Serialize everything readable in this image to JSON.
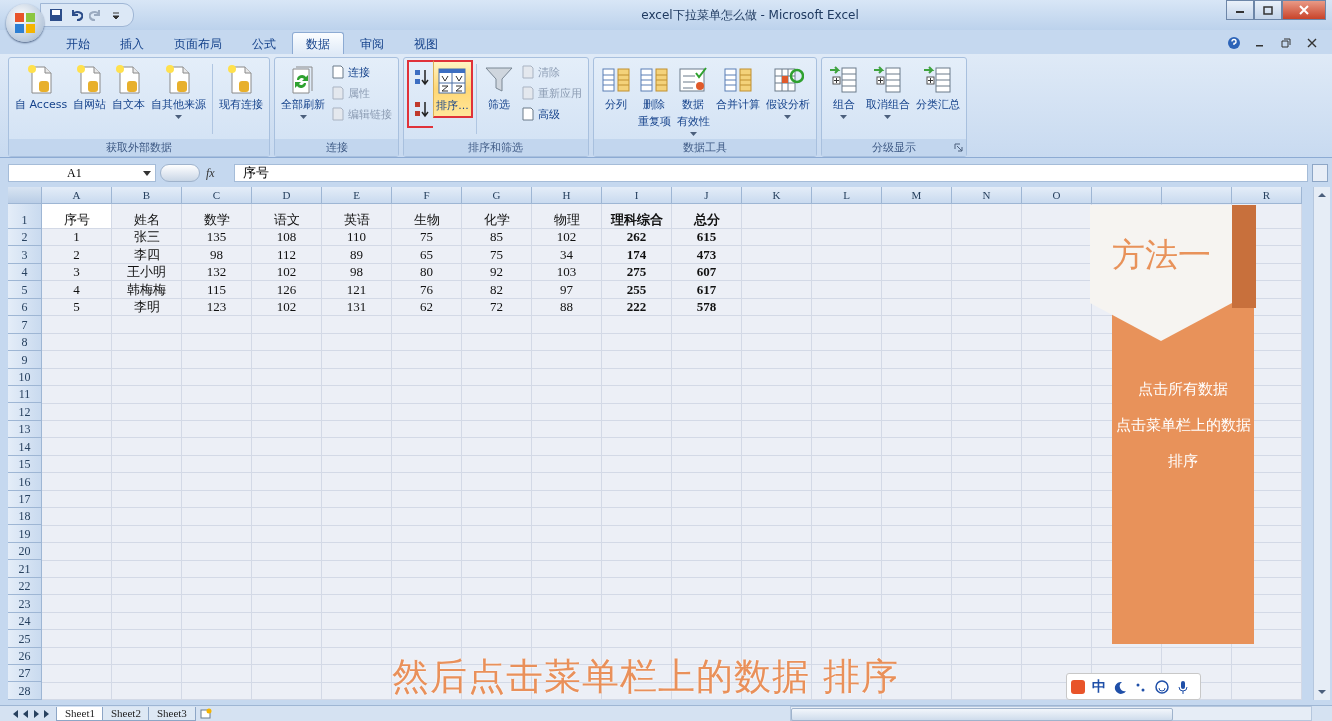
{
  "window": {
    "title": "excel下拉菜单怎么做 - Microsoft Excel"
  },
  "tabs": [
    {
      "label": "开始",
      "selected": false
    },
    {
      "label": "插入",
      "selected": false
    },
    {
      "label": "页面布局",
      "selected": false
    },
    {
      "label": "公式",
      "selected": false
    },
    {
      "label": "数据",
      "selected": true
    },
    {
      "label": "审阅",
      "selected": false
    },
    {
      "label": "视图",
      "selected": false
    }
  ],
  "ribbon_groups": [
    {
      "label": "获取外部数据",
      "launcher": false,
      "columns": [
        {
          "kind": "large",
          "label": "自 Access",
          "dropdown": false
        },
        {
          "kind": "large",
          "label": "自网站",
          "dropdown": false
        },
        {
          "kind": "large",
          "label": "自文本",
          "dropdown": false
        },
        {
          "kind": "large",
          "label": "自其他来源",
          "dropdown": true
        },
        {
          "kind": "separator"
        },
        {
          "kind": "large",
          "label": "现有连接",
          "dropdown": false
        }
      ]
    },
    {
      "label": "连接",
      "launcher": false,
      "columns": [
        {
          "kind": "large",
          "label": "全部刷新",
          "dropdown": true
        },
        {
          "kind": "stack",
          "buttons": [
            {
              "label": "连接",
              "disabled": false
            },
            {
              "label": "属性",
              "disabled": true
            },
            {
              "label": "编辑链接",
              "disabled": true
            }
          ]
        }
      ]
    },
    {
      "label": "排序和筛选",
      "launcher": false,
      "columns": [
        {
          "kind": "sort-icons",
          "outlined": true
        },
        {
          "kind": "large",
          "label": "排序...",
          "dropdown": false,
          "highlighted": true,
          "outlined": true
        },
        {
          "kind": "separator"
        },
        {
          "kind": "large",
          "label": "筛选",
          "dropdown": false
        },
        {
          "kind": "stack",
          "buttons": [
            {
              "label": "清除",
              "disabled": true
            },
            {
              "label": "重新应用",
              "disabled": true
            },
            {
              "label": "高级",
              "disabled": false
            }
          ]
        }
      ]
    },
    {
      "label": "数据工具",
      "launcher": false,
      "columns": [
        {
          "kind": "large",
          "label": "分列",
          "dropdown": false
        },
        {
          "kind": "large",
          "label_lines": [
            "删除",
            "重复项"
          ],
          "dropdown": false
        },
        {
          "kind": "large",
          "label_lines": [
            "数据",
            "有效性"
          ],
          "dropdown": true
        },
        {
          "kind": "large",
          "label": "合并计算",
          "dropdown": false
        },
        {
          "kind": "large",
          "label": "假设分析",
          "dropdown": true
        }
      ]
    },
    {
      "label": "分级显示",
      "launcher": true,
      "columns": [
        {
          "kind": "large",
          "label": "组合",
          "dropdown": true
        },
        {
          "kind": "large",
          "label": "取消组合",
          "dropdown": true
        },
        {
          "kind": "large",
          "label": "分类汇总",
          "dropdown": false
        }
      ]
    }
  ],
  "formula_bar": {
    "name_box": "A1",
    "function_label": "fx",
    "formula": "序号"
  },
  "columns": [
    {
      "letter": "A"
    },
    {
      "letter": "B"
    },
    {
      "letter": "C"
    },
    {
      "letter": "D"
    },
    {
      "letter": "E"
    },
    {
      "letter": "F"
    },
    {
      "letter": "G"
    },
    {
      "letter": "H"
    },
    {
      "letter": "I",
      "bold": true
    },
    {
      "letter": "J",
      "bold": true
    },
    {
      "letter": "K"
    },
    {
      "letter": "L"
    },
    {
      "letter": "M"
    },
    {
      "letter": "N"
    },
    {
      "letter": "O"
    },
    {},
    {},
    {
      "letter": "R"
    }
  ],
  "rows": [
    {
      "number": "1",
      "cells": [
        {
          "text": "序号",
          "selected": true
        },
        {
          "text": "姓名",
          "selected": false
        },
        {
          "text": "数学",
          "selected": false
        },
        {
          "text": "语文",
          "selected": false
        },
        {
          "text": "英语",
          "selected": false
        },
        {
          "text": "生物",
          "selected": false
        },
        {
          "text": "化学",
          "selected": false
        },
        {
          "text": "物理",
          "selected": false
        },
        {
          "text": "理科综合",
          "selected": false
        },
        {
          "text": "总分",
          "selected": false
        }
      ]
    },
    {
      "number": "2",
      "cells": [
        {
          "text": "1",
          "selected": false
        },
        {
          "text": "张三",
          "selected": false
        },
        {
          "text": "135",
          "selected": false
        },
        {
          "text": "108",
          "selected": false
        },
        {
          "text": "110",
          "selected": false
        },
        {
          "text": "75",
          "selected": false
        },
        {
          "text": "85",
          "selected": false
        },
        {
          "text": "102",
          "selected": false
        },
        {
          "text": "262",
          "selected": false
        },
        {
          "text": "615",
          "selected": false
        }
      ]
    },
    {
      "number": "3",
      "cells": [
        {
          "text": "2",
          "selected": false
        },
        {
          "text": "李四",
          "selected": false
        },
        {
          "text": "98",
          "selected": false
        },
        {
          "text": "112",
          "selected": false
        },
        {
          "text": "89",
          "selected": false
        },
        {
          "text": "65",
          "selected": false
        },
        {
          "text": "75",
          "selected": false
        },
        {
          "text": "34",
          "selected": false
        },
        {
          "text": "174",
          "selected": false
        },
        {
          "text": "473",
          "selected": false
        }
      ]
    },
    {
      "number": "4",
      "cells": [
        {
          "text": "3",
          "selected": false
        },
        {
          "text": "王小明",
          "selected": false
        },
        {
          "text": "132",
          "selected": false
        },
        {
          "text": "102",
          "selected": false
        },
        {
          "text": "98",
          "selected": false
        },
        {
          "text": "80",
          "selected": false
        },
        {
          "text": "92",
          "selected": false
        },
        {
          "text": "103",
          "selected": false
        },
        {
          "text": "275",
          "selected": false
        },
        {
          "text": "607",
          "selected": false
        }
      ]
    },
    {
      "number": "5",
      "cells": [
        {
          "text": "4",
          "selected": false
        },
        {
          "text": "韩梅梅",
          "selected": false
        },
        {
          "text": "115",
          "selected": false
        },
        {
          "text": "126",
          "selected": false
        },
        {
          "text": "121",
          "selected": false
        },
        {
          "text": "76",
          "selected": false
        },
        {
          "text": "82",
          "selected": false
        },
        {
          "text": "97",
          "selected": false
        },
        {
          "text": "255",
          "selected": false
        },
        {
          "text": "617",
          "selected": false
        }
      ]
    },
    {
      "number": "6",
      "cells": [
        {
          "text": "5",
          "selected": false
        },
        {
          "text": "李明",
          "selected": false
        },
        {
          "text": "123",
          "selected": false
        },
        {
          "text": "102",
          "selected": false
        },
        {
          "text": "131",
          "selected": false
        },
        {
          "text": "62",
          "selected": false
        },
        {
          "text": "72",
          "selected": false
        },
        {
          "text": "88",
          "selected": false
        },
        {
          "text": "222",
          "selected": false
        },
        {
          "text": "578",
          "selected": false
        }
      ]
    },
    {
      "number": "7"
    },
    {
      "number": "8"
    },
    {
      "number": "9"
    },
    {
      "number": "10"
    },
    {
      "number": "11"
    },
    {
      "number": "12"
    },
    {
      "number": "13"
    },
    {
      "number": "14"
    },
    {
      "number": "15"
    },
    {
      "number": "16"
    },
    {
      "number": "17"
    },
    {
      "number": "18"
    },
    {
      "number": "19"
    },
    {
      "number": "20"
    },
    {
      "number": "21"
    },
    {
      "number": "22"
    },
    {
      "number": "23"
    },
    {
      "number": "24"
    },
    {
      "number": "25"
    },
    {
      "number": "26"
    },
    {
      "number": "27"
    },
    {
      "number": "28"
    }
  ],
  "sheet_tabs": [
    {
      "label": "Sheet1",
      "selected": true
    },
    {
      "label": "Sheet2",
      "selected": false
    },
    {
      "label": "Sheet3",
      "selected": false
    }
  ],
  "overlay": {
    "banner_title": "方法一",
    "banner_lines": [
      "点击所有数据",
      "点击菜单栏上的数据",
      "排序"
    ],
    "subtitle": "然后点击菜单栏上的数据 排序"
  },
  "ime": {
    "mode": "中"
  }
}
